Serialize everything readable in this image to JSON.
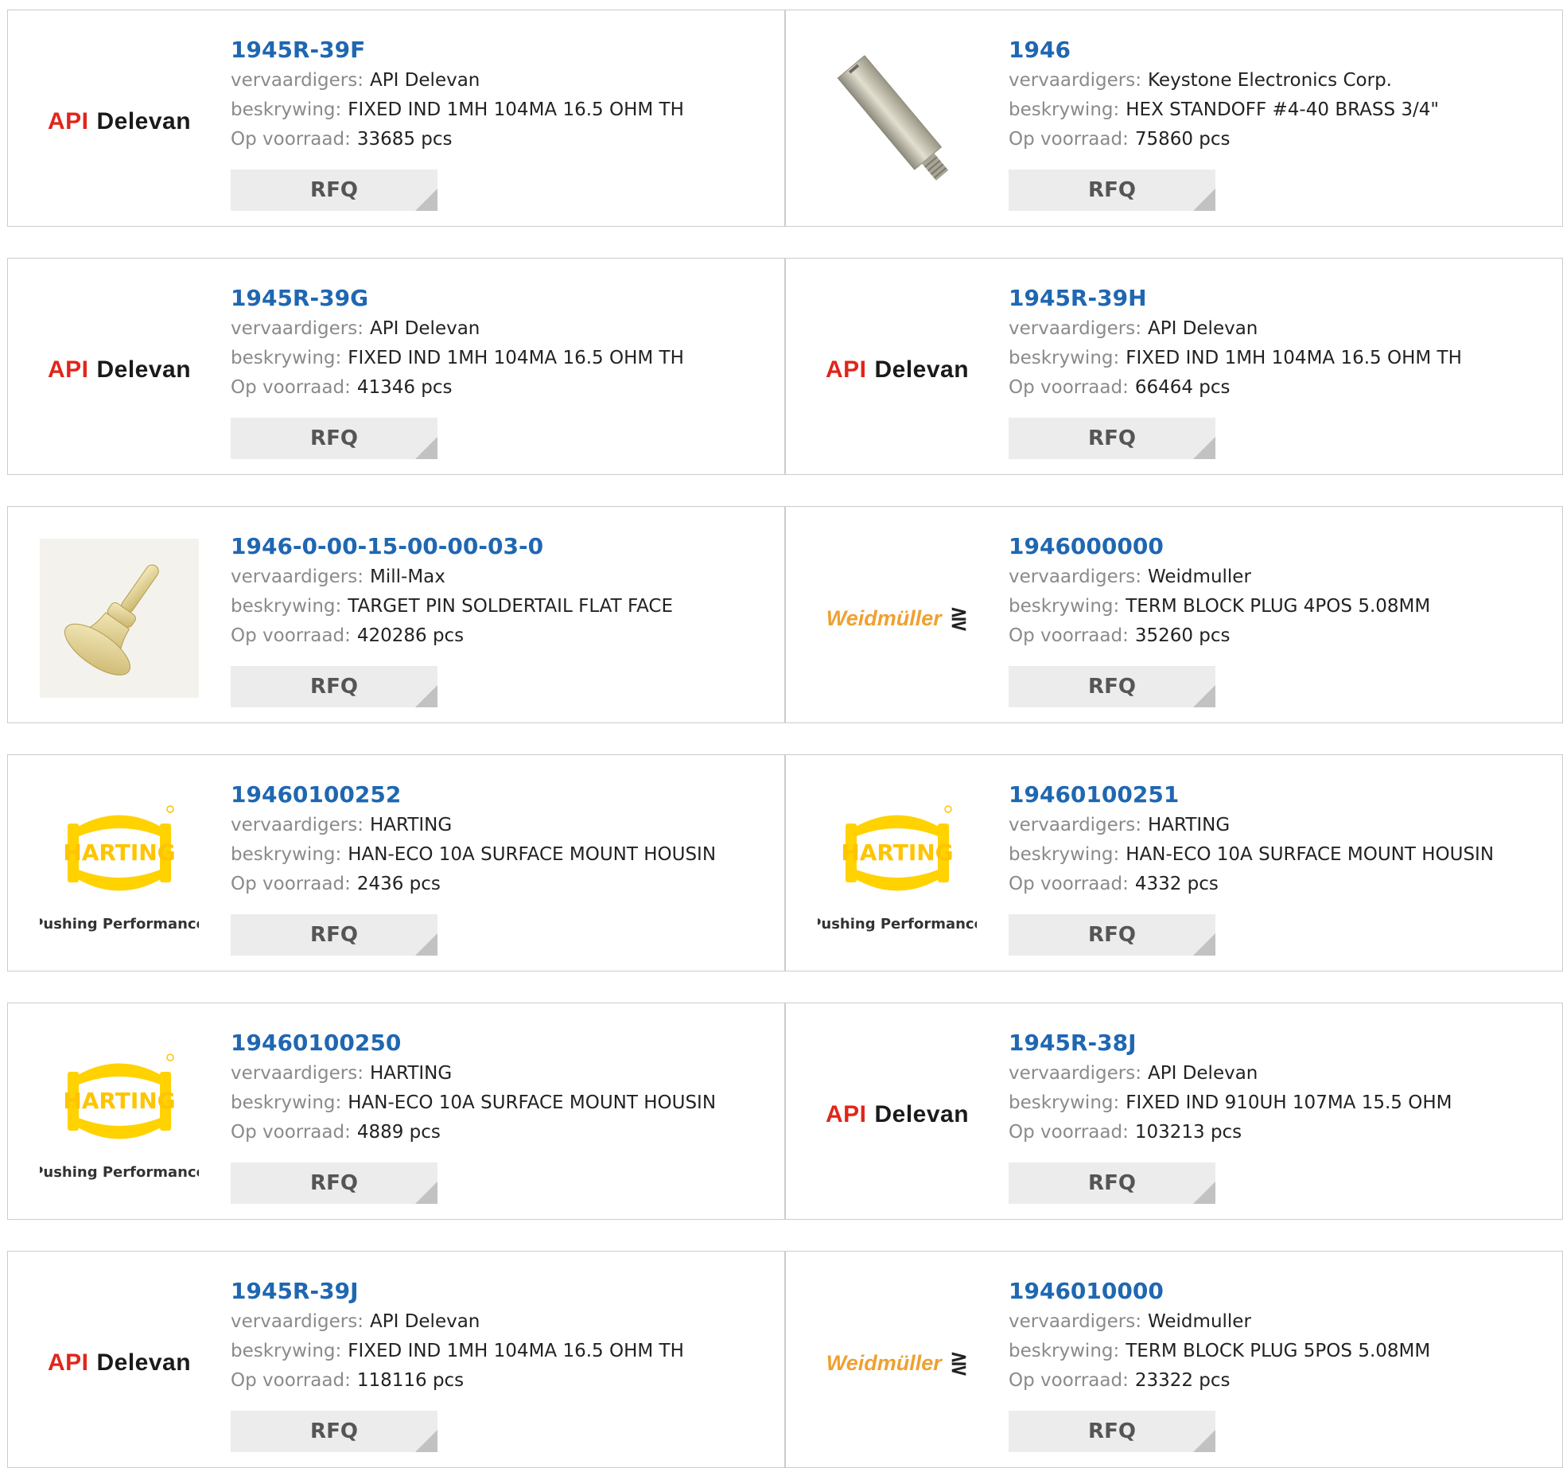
{
  "labels": {
    "manufacturer": "vervaardigers:",
    "description": "beskrywing:",
    "stock": "Op voorraad:",
    "rfq": "RFQ"
  },
  "colors": {
    "part_number": "#1f67b1",
    "label": "#8a8a8a",
    "value": "#222222",
    "rfq_bg": "#ececec"
  },
  "logos": {
    "api": {
      "part1": "API",
      "part2": "Delevan"
    },
    "weidmuller": {
      "text": "Weidmüller",
      "mark": "⋛"
    },
    "harting": {
      "name": "HARTING",
      "tagline": "Pushing Performance"
    }
  },
  "products": [
    {
      "pn": "1945R-39F",
      "manufacturer": "API Delevan",
      "description": "FIXED IND 1MH 104MA 16.5 OHM TH",
      "stock": "33685 pcs",
      "image": "api-delevan-logo"
    },
    {
      "pn": "1946",
      "manufacturer": "Keystone Electronics Corp.",
      "description": "HEX STANDOFF #4-40 BRASS 3/4\"",
      "stock": "75860 pcs",
      "image": "hex-standoff-photo"
    },
    {
      "pn": "1945R-39G",
      "manufacturer": "API Delevan",
      "description": "FIXED IND 1MH 104MA 16.5 OHM TH",
      "stock": "41346 pcs",
      "image": "api-delevan-logo"
    },
    {
      "pn": "1945R-39H",
      "manufacturer": "API Delevan",
      "description": "FIXED IND 1MH 104MA 16.5 OHM TH",
      "stock": "66464 pcs",
      "image": "api-delevan-logo"
    },
    {
      "pn": "1946-0-00-15-00-00-03-0",
      "manufacturer": "Mill-Max",
      "description": "TARGET PIN SOLDERTAIL FLAT FACE",
      "stock": "420286 pcs",
      "image": "target-pin-photo"
    },
    {
      "pn": "1946000000",
      "manufacturer": "Weidmuller",
      "description": "TERM BLOCK PLUG 4POS 5.08MM",
      "stock": "35260 pcs",
      "image": "weidmuller-logo"
    },
    {
      "pn": "19460100252",
      "manufacturer": "HARTING",
      "description": "HAN-ECO 10A SURFACE MOUNT HOUSIN",
      "stock": "2436 pcs",
      "image": "harting-logo"
    },
    {
      "pn": "19460100251",
      "manufacturer": "HARTING",
      "description": "HAN-ECO 10A SURFACE MOUNT HOUSIN",
      "stock": "4332 pcs",
      "image": "harting-logo"
    },
    {
      "pn": "19460100250",
      "manufacturer": "HARTING",
      "description": "HAN-ECO 10A SURFACE MOUNT HOUSIN",
      "stock": "4889 pcs",
      "image": "harting-logo"
    },
    {
      "pn": "1945R-38J",
      "manufacturer": "API Delevan",
      "description": "FIXED IND 910UH 107MA 15.5 OHM",
      "stock": "103213 pcs",
      "image": "api-delevan-logo"
    },
    {
      "pn": "1945R-39J",
      "manufacturer": "API Delevan",
      "description": "FIXED IND 1MH 104MA 16.5 OHM TH",
      "stock": "118116 pcs",
      "image": "api-delevan-logo"
    },
    {
      "pn": "1946010000",
      "manufacturer": "Weidmuller",
      "description": "TERM BLOCK PLUG 5POS 5.08MM",
      "stock": "23322 pcs",
      "image": "weidmuller-logo"
    }
  ]
}
